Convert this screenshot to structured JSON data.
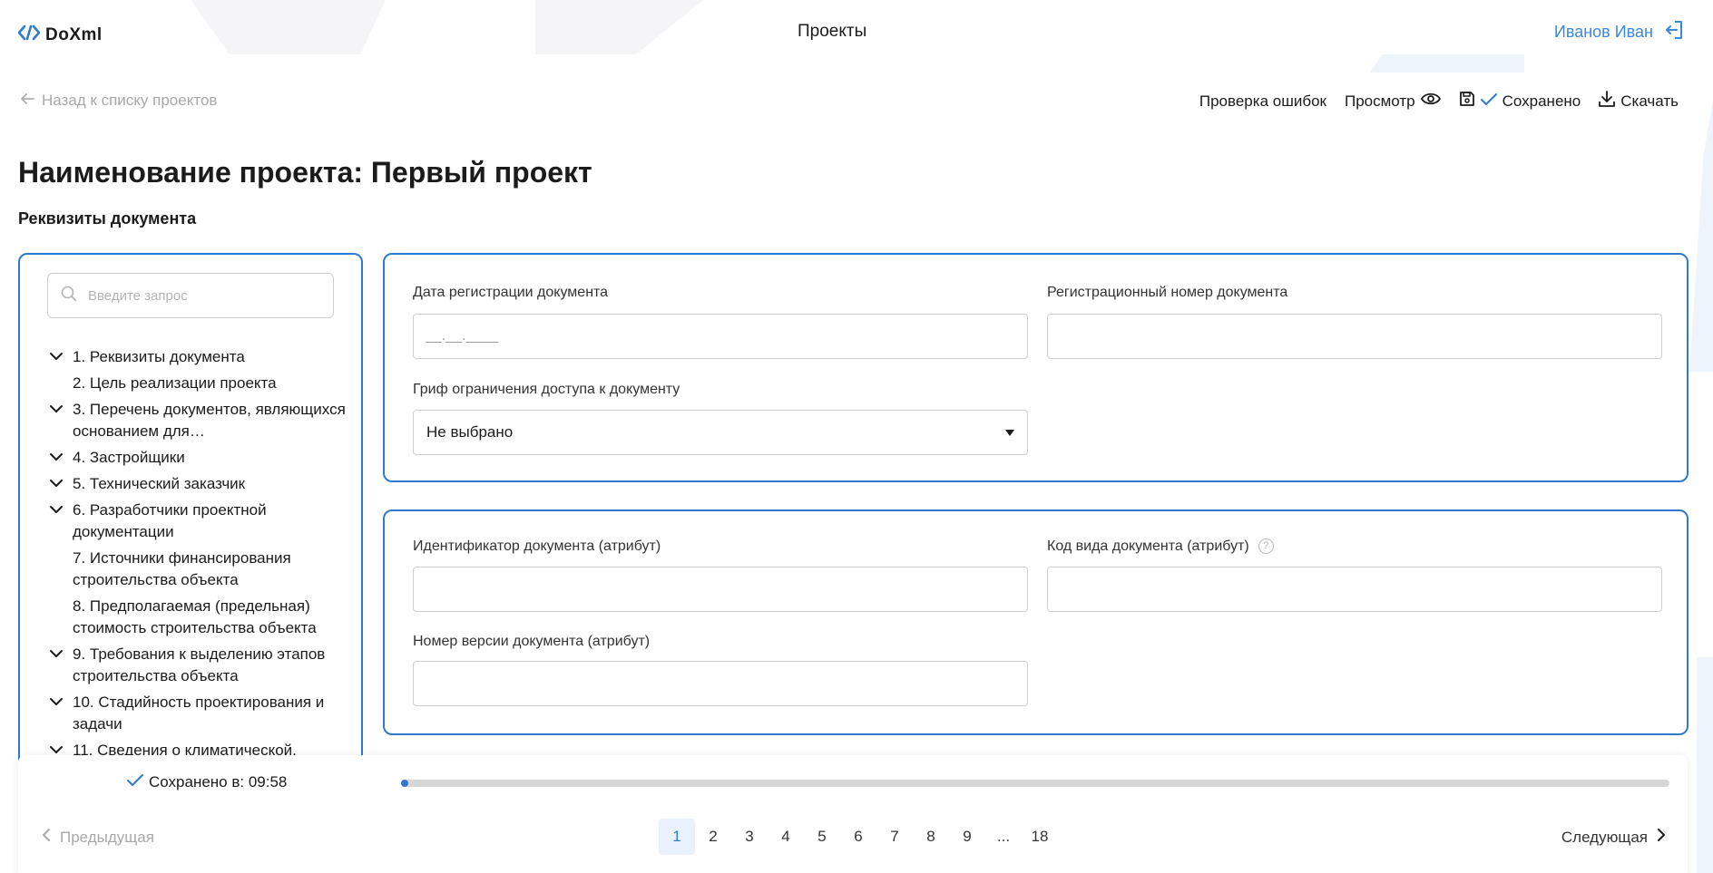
{
  "header": {
    "logo_text": "DoXml",
    "nav_title": "Проекты",
    "user_name": "Иванов Иван"
  },
  "toolbar": {
    "back_label": "Назад к списку проектов",
    "check_errors_label": "Проверка ошибок",
    "preview_label": "Просмотр",
    "saved_label": "Сохранено",
    "download_label": "Скачать"
  },
  "page": {
    "title": "Наименование проекта: Первый проект",
    "section_title": "Реквизиты документа"
  },
  "sidebar": {
    "search_placeholder": "Введите запрос",
    "items": [
      {
        "label": "1. Реквизиты документа",
        "expandable": true,
        "active": true
      },
      {
        "label": "2. Цель реализации проекта",
        "expandable": false,
        "active": false
      },
      {
        "label": "3. Перечень документов, являющихся основанием для…",
        "expandable": true,
        "active": false
      },
      {
        "label": "4. Застройщики",
        "expandable": true,
        "active": false
      },
      {
        "label": "5. Технический заказчик",
        "expandable": true,
        "active": false
      },
      {
        "label": "6. Разработчики проектной документации",
        "expandable": true,
        "active": false
      },
      {
        "label": "7. Источники финансирования строительства объекта",
        "expandable": false,
        "active": false
      },
      {
        "label": "8. Предполагаемая (предельная) стоимость строительства объекта",
        "expandable": false,
        "active": false
      },
      {
        "label": "9. Требования к выделению этапов строительства объекта",
        "expandable": true,
        "active": false
      },
      {
        "label": "10. Стадийность проектирования и задачи",
        "expandable": true,
        "active": false
      },
      {
        "label": "11. Сведения о климатической,",
        "expandable": true,
        "active": false
      }
    ]
  },
  "form": {
    "reg_date_label": "Дата регистрации документа",
    "reg_date_placeholder": "__.__.____",
    "reg_number_label": "Регистрационный номер документа",
    "reg_number_value": "",
    "access_label": "Гриф ограничения доступа к документу",
    "access_value": "Не выбрано",
    "doc_id_label": "Идентификатор документа (атрибут)",
    "doc_id_value": "",
    "doc_type_label": "Код вида документа (атрибут)",
    "doc_type_value": "",
    "help_glyph": "?",
    "version_label": "Номер версии документа (атрибут)",
    "version_value": ""
  },
  "footer": {
    "saved_at_label": "Сохранено в: 09:58",
    "progress_percent": 0.5,
    "prev_label": "Предыдущая",
    "next_label": "Следующая",
    "pages": [
      "1",
      "2",
      "3",
      "4",
      "5",
      "6",
      "7",
      "8",
      "9",
      "...",
      "18"
    ],
    "current_page": "1"
  },
  "colors": {
    "accent": "#2f7ad0",
    "user_link": "#3a88d6",
    "muted": "#a8a8a8"
  }
}
